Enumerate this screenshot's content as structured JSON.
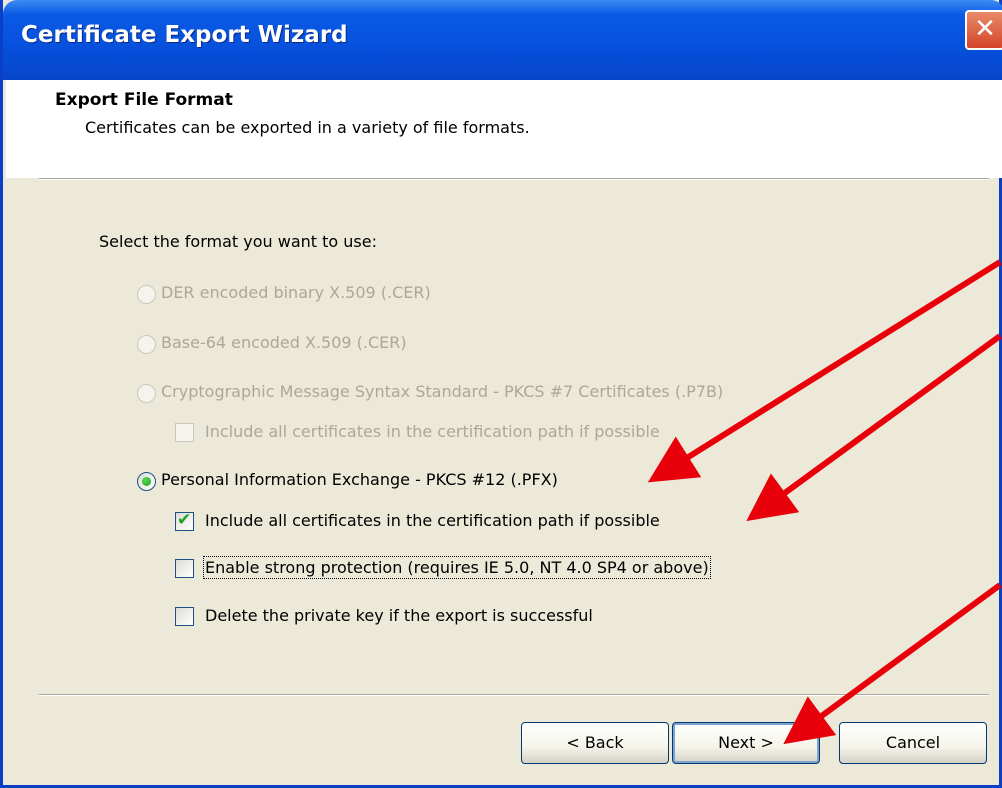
{
  "window": {
    "title": "Certificate Export Wizard",
    "close_label": "✕"
  },
  "header": {
    "title": "Export File Format",
    "subtitle": "Certificates can be exported in a variety of file formats."
  },
  "prompt": "Select the format you want to use:",
  "options": {
    "der": {
      "label": "DER encoded binary X.509 (.CER)",
      "enabled": false,
      "selected": false
    },
    "base64": {
      "label": "Base-64 encoded X.509 (.CER)",
      "enabled": false,
      "selected": false
    },
    "pkcs7": {
      "label": "Cryptographic Message Syntax Standard - PKCS #7 Certificates (.P7B)",
      "enabled": false,
      "selected": false
    },
    "pkcs7_include": {
      "label": "Include all certificates in the certification path if possible",
      "enabled": false,
      "checked": false
    },
    "pfx": {
      "label": "Personal Information Exchange - PKCS #12 (.PFX)",
      "enabled": true,
      "selected": true
    },
    "pfx_include": {
      "label": "Include all certificates in the certification path if possible",
      "enabled": true,
      "checked": true
    },
    "strong_protection": {
      "label": "Enable strong protection (requires IE 5.0, NT 4.0 SP4 or above)",
      "enabled": true,
      "checked": false
    },
    "delete_key": {
      "label": "Delete the private key if the export is successful",
      "enabled": true,
      "checked": false
    }
  },
  "buttons": {
    "back": "< Back",
    "next": "Next >",
    "cancel": "Cancel"
  },
  "annotation_color": "#E8000B"
}
